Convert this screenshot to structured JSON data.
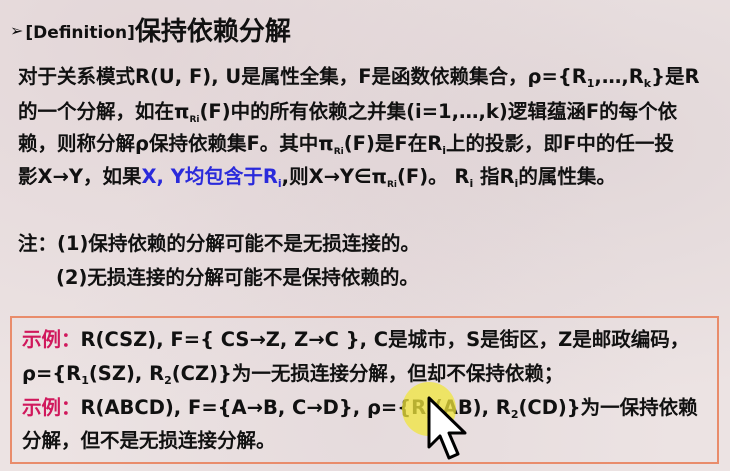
{
  "title": {
    "tag": "[Definition]",
    "text": "保持依赖分解"
  },
  "def": {
    "l1a": "对于关系模式R(U, F), U是属性全集，F是函数依赖集合，ρ={R",
    "sub1": "1",
    "l1b": ",…,R",
    "subk": "k",
    "l1c": "}是R",
    "pi": "π",
    "pisub": "Ri",
    "subi": "i",
    "l2a": "的一个分解，如在",
    "l2b": "(F)中的所有依赖之并集(i=1,…,k)逻辑蕴涵F的每个依",
    "l3a": "赖，则称分解ρ保持依赖集F。其中",
    "l3b": "(F)是F在R",
    "l3c": "上的投影，即F中的任一投",
    "l4a": "影X→Y，如果",
    "l4blue": "X, Y均包含于R",
    "l4b": ",则X→Y∈",
    "l4c": "(F)。 R",
    "l4d": " 指R",
    "l4e": "的属性集。"
  },
  "note": {
    "l1": "注：(1)保持依赖的分解可能不是无损连接的。",
    "l2": "(2)无损连接的分解可能不是保持依赖的。"
  },
  "ex": {
    "label": "示例：",
    "one": "1",
    "two": "2",
    "e1l1": "R(CSZ), F={ CS→Z, Z→C }, C是城市，S是街区，Z是邮政编码，",
    "e1l2a": "ρ={R",
    "e1l2b": "(SZ), R",
    "e1l2c": "(CZ)}为一无损连接分解，但却不保持依赖；",
    "e2l1a": "R(ABCD), F={A→B, C→D}, ρ={R",
    "e2l1b": "(AB), R",
    "e2l1c": "(CD)}为一保持依赖",
    "e2l2": "分解，但不是无损连接分解。"
  },
  "colors": {
    "accent_red": "#d0185c",
    "accent_blue": "#2a2adb",
    "box_border": "#e98c6b"
  },
  "icons": {
    "bullet": "bullet-arrow-icon",
    "cursor": "mouse-cursor-icon"
  }
}
